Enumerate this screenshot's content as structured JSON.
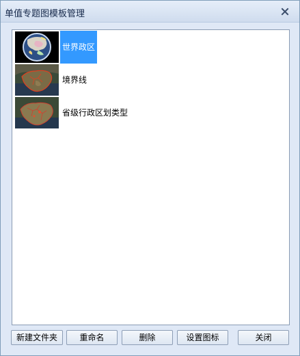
{
  "window": {
    "title": "单值专题图模板管理"
  },
  "list": {
    "items": [
      {
        "label": "世界政区",
        "selected": true,
        "icon": "globe-asia-thumbnail-icon"
      },
      {
        "label": "境界线",
        "selected": false,
        "icon": "china-boundary-thumbnail-icon"
      },
      {
        "label": "省级行政区划类型",
        "selected": false,
        "icon": "china-province-thumbnail-icon"
      }
    ]
  },
  "buttons": {
    "new_folder": "新建文件夹",
    "rename": "重命名",
    "delete": "删除",
    "set_icon": "设置图标",
    "close": "关闭"
  },
  "colors": {
    "selection": "#3399ff",
    "window_bg": "#dfe8f6",
    "title_text": "#15284a"
  }
}
